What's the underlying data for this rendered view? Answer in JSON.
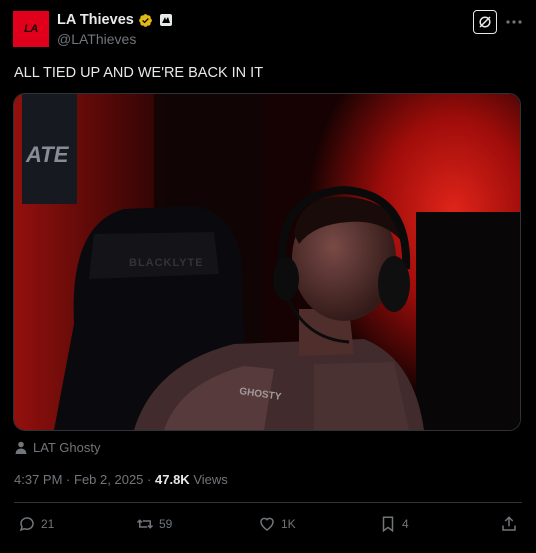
{
  "author": {
    "avatar_text": "LA",
    "display_name": "LA Thieves",
    "handle": "@LAThieves",
    "brand_color": "#e1001b"
  },
  "tweet": {
    "text": "ALL TIED UP AND WE'RE BACK IN IT"
  },
  "media": {
    "chair_brand": "BLACKLYTE",
    "jersey_name": "GHOSTY",
    "banner_text": "ATE"
  },
  "tag": {
    "icon": "person-icon",
    "label": "LAT Ghosty"
  },
  "meta": {
    "time": "4:37 PM",
    "separator": "·",
    "date": "Feb 2, 2025",
    "separator2": "·",
    "views_count": "47.8K",
    "views_label": "Views"
  },
  "actions": {
    "replies": "21",
    "reposts": "59",
    "likes": "1K",
    "bookmarks": "4"
  }
}
